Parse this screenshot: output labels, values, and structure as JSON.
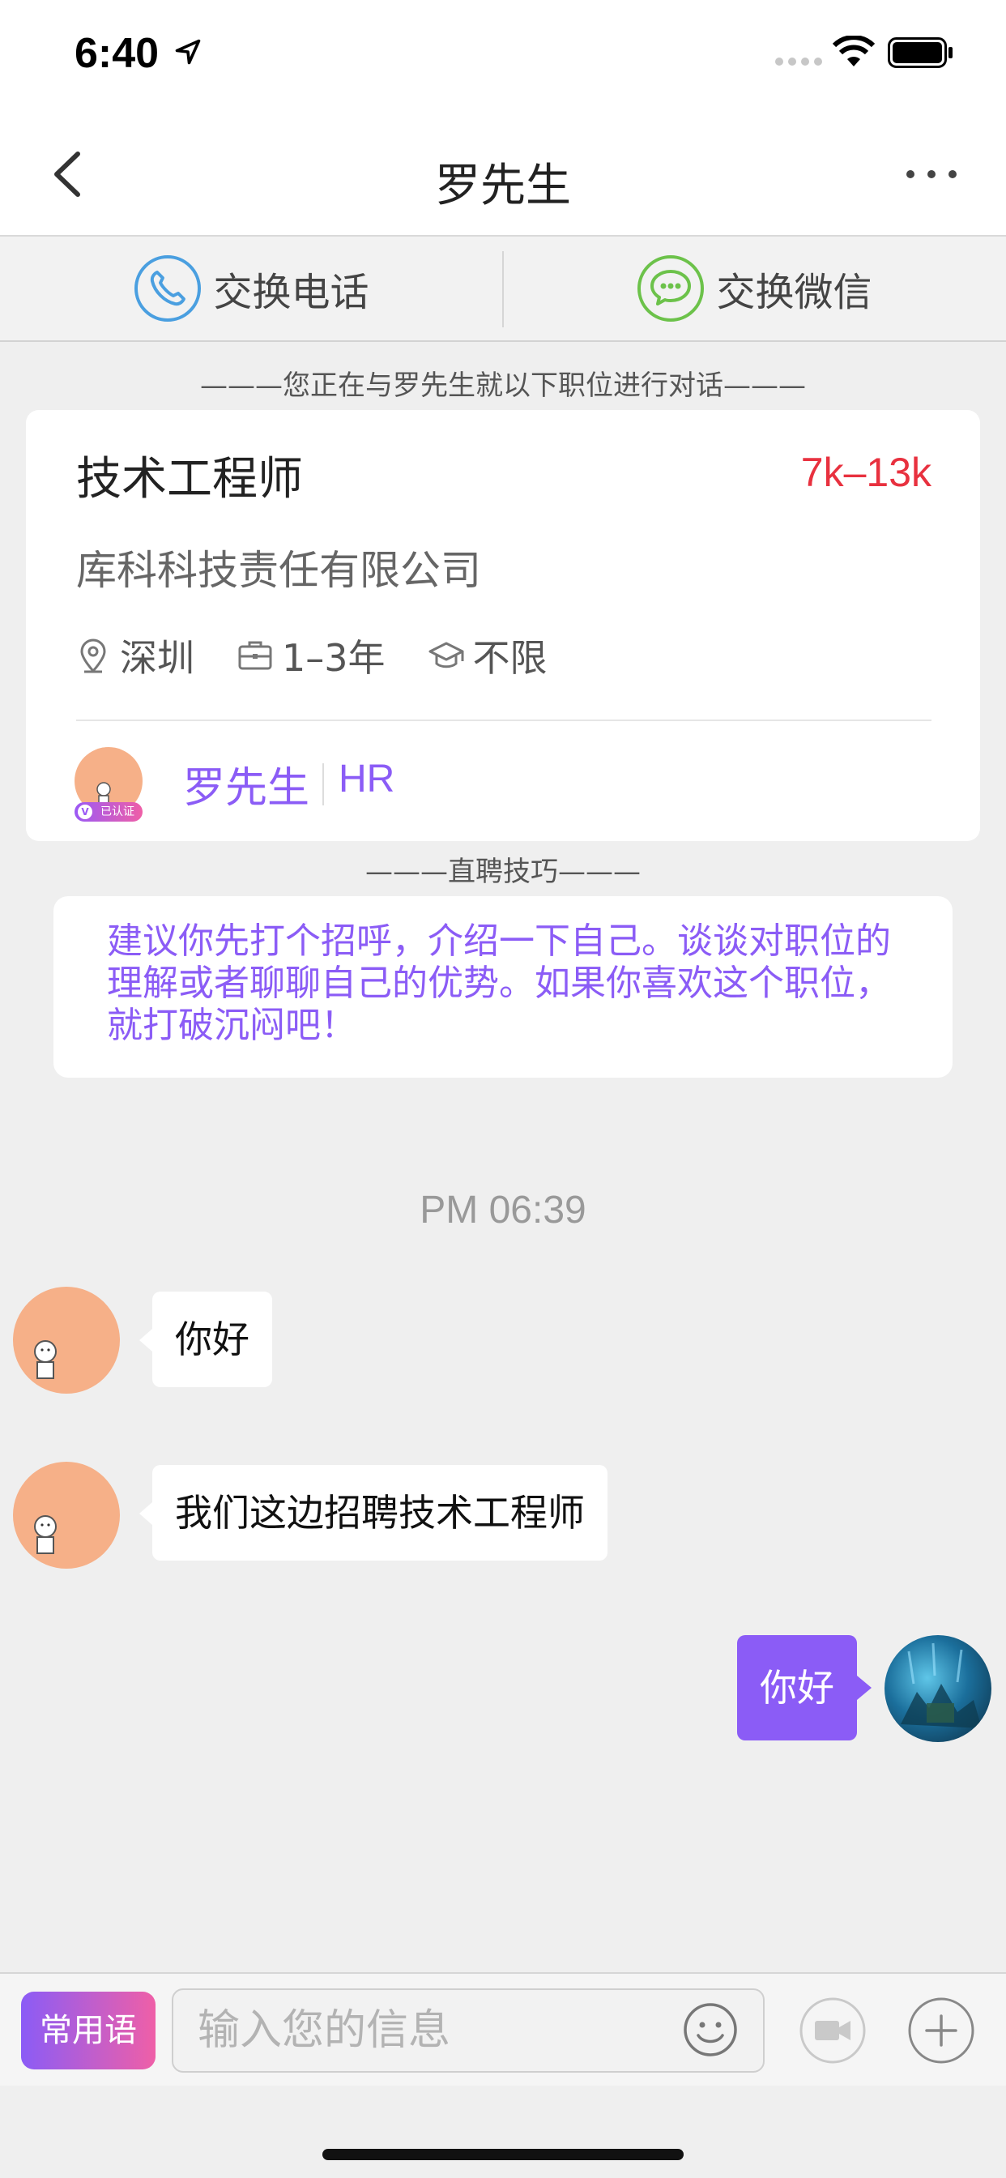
{
  "status_bar": {
    "time": "6:40"
  },
  "nav": {
    "title": "罗先生"
  },
  "exchange": {
    "phone_label": "交换电话",
    "wechat_label": "交换微信"
  },
  "conversation_note": "———您正在与罗先生就以下职位进行对话———",
  "job": {
    "title": "技术工程师",
    "salary": "7k–13k",
    "company": "库科科技责任有限公司",
    "location": "深圳",
    "experience": "1–3年",
    "education": "不限"
  },
  "recruiter": {
    "name": "罗先生",
    "role": "HR",
    "badge": "已认证",
    "badge_mark": "V"
  },
  "tip": {
    "header": "———直聘技巧———",
    "text": "建议你先打个招呼，介绍一下自己。谈谈对职位的理解或者聊聊自己的优势。如果你喜欢这个职位，就打破沉闷吧！"
  },
  "timestamp": "PM 06:39",
  "messages": [
    {
      "side": "left",
      "text": "你好"
    },
    {
      "side": "left",
      "text": "我们这边招聘技术工程师"
    },
    {
      "side": "right",
      "text": "你好"
    }
  ],
  "input": {
    "phrases_label": "常用语",
    "placeholder": "输入您的信息"
  },
  "colors": {
    "accent": "#8b5cf6",
    "salary": "#e8313f",
    "phone_icon": "#4a9fe0",
    "wechat_icon": "#6cc24a"
  }
}
